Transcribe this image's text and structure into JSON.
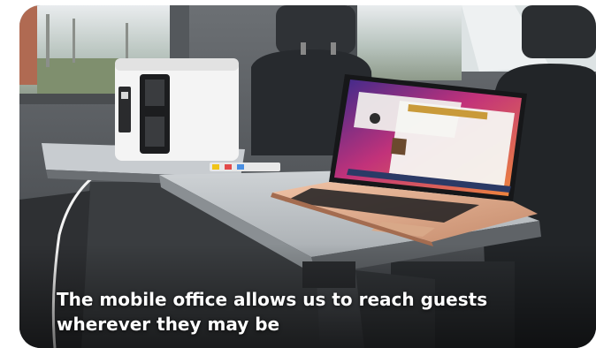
{
  "photo": {
    "scene": "van-interior-mobile-office",
    "caption": {
      "line1": "The mobile office allows us to reach guests",
      "line2": "wherever they may be"
    }
  }
}
